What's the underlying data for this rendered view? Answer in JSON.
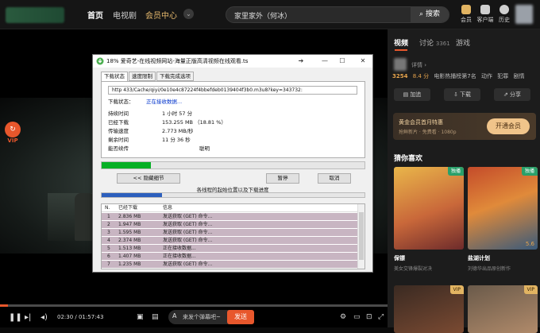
{
  "topbar": {
    "nav": [
      "首页",
      "电视剧",
      "会员中心"
    ],
    "search_text": "家里家外（何冰）",
    "search_button": "搜索",
    "icons": [
      {
        "name": "vip-crown",
        "label": "会员"
      },
      {
        "name": "client",
        "label": "客户端"
      },
      {
        "name": "history",
        "label": "历史"
      }
    ]
  },
  "player": {
    "vip_badge": "VIP",
    "time": "02:30 / 01:57:43",
    "danmu_placeholder": "来发个弹幕吧~",
    "send": "发送",
    "progress_fraction": 0.021
  },
  "rpanel": {
    "tabs": [
      "视频",
      "讨论",
      "游戏"
    ],
    "discuss_count": "3361",
    "detail_link": "详情 ›",
    "stats": {
      "hot": "3254",
      "score": "8.4 分",
      "rank": "电影热播榜第7名",
      "tags": [
        "动作",
        "犯罪",
        "剧情"
      ]
    },
    "actions": [
      "加追",
      "下载",
      "分享"
    ],
    "vip_banner": {
      "title": "黄金会员首月特惠",
      "subtitle": "抢鲜新片 · 免费看 · 1080p",
      "button": "开通会员"
    },
    "guess_title": "猜你喜欢",
    "cards": [
      {
        "title": "保镖",
        "subtitle": "美女交锋爆裂对决",
        "tag": "独播",
        "score": ""
      },
      {
        "title": "盐湖计划",
        "subtitle": "刘德华出品原创新作",
        "tag": "独播",
        "score": "5.6"
      },
      {
        "title": "",
        "subtitle": "",
        "tag": "VIP",
        "score": ""
      },
      {
        "title": "",
        "subtitle": "",
        "tag": "VIP",
        "score": ""
      }
    ]
  },
  "dialog": {
    "title": "18% 爱奇艺-在线视频网站-海量正版高清视频在线观看.ts",
    "tabs": [
      "下载状态",
      "速度限制",
      "下载完成选项"
    ],
    "url": "http                                 433/Cache/qiyi/0e10e4c87224f4bbefdeb0139404f3b0.m3u8?key=343732:",
    "status_label": "下载状态：",
    "status_value": "正在接收数据...",
    "rows": [
      {
        "k": "持续时间",
        "v": "1 小时 57 分"
      },
      {
        "k": "已经下载",
        "v": "153.255  MB （18.81 %）"
      },
      {
        "k": "传输速度",
        "v": "2.773  MB/秒"
      },
      {
        "k": "剩余时间",
        "v": "11 分 36 秒"
      },
      {
        "k": "能否续传",
        "v": "",
        "v2": "聪明"
      }
    ],
    "progress_fraction": 0.1881,
    "hide_btn": "<< 隐藏细节",
    "pause_btn": "暂停",
    "cancel_btn": "取消",
    "seg_label": "各线程的起始位置以及下载进度",
    "seg_fraction": 0.23,
    "table_headers": [
      "N.",
      "已经下载",
      "信息"
    ],
    "threads": [
      [
        "1",
        "2.836  MB",
        "发送获取 (GET) 命令..."
      ],
      [
        "2",
        "1.947  MB",
        "发送获取 (GET) 命令..."
      ],
      [
        "3",
        "1.595  MB",
        "发送获取 (GET) 命令..."
      ],
      [
        "4",
        "2.374  MB",
        "发送获取 (GET) 命令..."
      ],
      [
        "5",
        "1.513  MB",
        "正在接收数据..."
      ],
      [
        "6",
        "1.407  MB",
        "正在接收数据..."
      ],
      [
        "7",
        "1.235  MB",
        "发送获取 (GET) 命令..."
      ]
    ]
  },
  "colors": {
    "accent": "#e8572c",
    "vip_gold": "#e2b462",
    "progress_green": "#06b025",
    "thread_row": "#c8b5c2"
  }
}
